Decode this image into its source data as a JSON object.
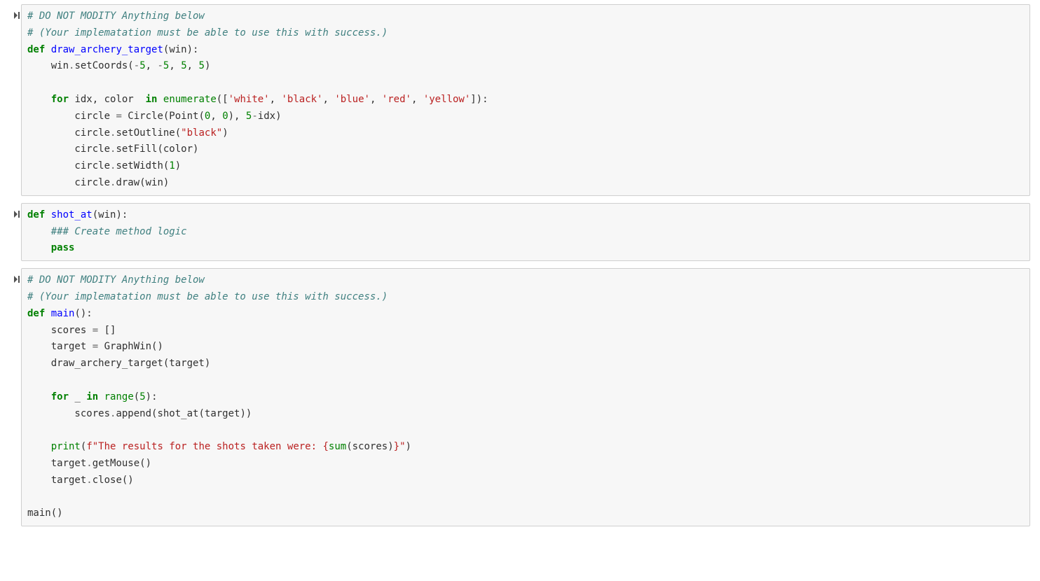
{
  "cells": [
    {
      "id": "cell-1",
      "lines": [
        [
          {
            "t": "# DO NOT MODITY Anything below",
            "c": "tok-comment"
          }
        ],
        [
          {
            "t": "# (Your implematation must be able to use this with success.)",
            "c": "tok-comment"
          }
        ],
        [
          {
            "t": "def",
            "c": "tok-kw"
          },
          {
            "t": " ",
            "c": ""
          },
          {
            "t": "draw_archery_target",
            "c": "tok-fn"
          },
          {
            "t": "(win):",
            "c": ""
          }
        ],
        [
          {
            "t": "    win",
            "c": ""
          },
          {
            "t": ".",
            "c": "tok-op"
          },
          {
            "t": "setCoords(",
            "c": ""
          },
          {
            "t": "-",
            "c": "tok-op"
          },
          {
            "t": "5",
            "c": "tok-num"
          },
          {
            "t": ", ",
            "c": ""
          },
          {
            "t": "-",
            "c": "tok-op"
          },
          {
            "t": "5",
            "c": "tok-num"
          },
          {
            "t": ", ",
            "c": ""
          },
          {
            "t": "5",
            "c": "tok-num"
          },
          {
            "t": ", ",
            "c": ""
          },
          {
            "t": "5",
            "c": "tok-num"
          },
          {
            "t": ")",
            "c": ""
          }
        ],
        [
          {
            "t": "",
            "c": ""
          }
        ],
        [
          {
            "t": "    ",
            "c": ""
          },
          {
            "t": "for",
            "c": "tok-kw"
          },
          {
            "t": " idx, color  ",
            "c": ""
          },
          {
            "t": "in",
            "c": "tok-kw"
          },
          {
            "t": " ",
            "c": ""
          },
          {
            "t": "enumerate",
            "c": "tok-builtin"
          },
          {
            "t": "([",
            "c": ""
          },
          {
            "t": "'white'",
            "c": "tok-str"
          },
          {
            "t": ", ",
            "c": ""
          },
          {
            "t": "'black'",
            "c": "tok-str"
          },
          {
            "t": ", ",
            "c": ""
          },
          {
            "t": "'blue'",
            "c": "tok-str"
          },
          {
            "t": ", ",
            "c": ""
          },
          {
            "t": "'red'",
            "c": "tok-str"
          },
          {
            "t": ", ",
            "c": ""
          },
          {
            "t": "'yellow'",
            "c": "tok-str"
          },
          {
            "t": "]):",
            "c": ""
          }
        ],
        [
          {
            "t": "        circle ",
            "c": ""
          },
          {
            "t": "=",
            "c": "tok-op"
          },
          {
            "t": " Circle(Point(",
            "c": ""
          },
          {
            "t": "0",
            "c": "tok-num"
          },
          {
            "t": ", ",
            "c": ""
          },
          {
            "t": "0",
            "c": "tok-num"
          },
          {
            "t": "), ",
            "c": ""
          },
          {
            "t": "5",
            "c": "tok-num"
          },
          {
            "t": "-",
            "c": "tok-op"
          },
          {
            "t": "idx)",
            "c": ""
          }
        ],
        [
          {
            "t": "        circle",
            "c": ""
          },
          {
            "t": ".",
            "c": "tok-op"
          },
          {
            "t": "setOutline(",
            "c": ""
          },
          {
            "t": "\"black\"",
            "c": "tok-str"
          },
          {
            "t": ")",
            "c": ""
          }
        ],
        [
          {
            "t": "        circle",
            "c": ""
          },
          {
            "t": ".",
            "c": "tok-op"
          },
          {
            "t": "setFill(color)",
            "c": ""
          }
        ],
        [
          {
            "t": "        circle",
            "c": ""
          },
          {
            "t": ".",
            "c": "tok-op"
          },
          {
            "t": "setWidth(",
            "c": ""
          },
          {
            "t": "1",
            "c": "tok-num"
          },
          {
            "t": ")",
            "c": ""
          }
        ],
        [
          {
            "t": "        circle",
            "c": ""
          },
          {
            "t": ".",
            "c": "tok-op"
          },
          {
            "t": "draw(win)",
            "c": ""
          }
        ]
      ]
    },
    {
      "id": "cell-2",
      "lines": [
        [
          {
            "t": "def",
            "c": "tok-kw"
          },
          {
            "t": " ",
            "c": ""
          },
          {
            "t": "shot_at",
            "c": "tok-fn"
          },
          {
            "t": "(win):",
            "c": ""
          }
        ],
        [
          {
            "t": "    ",
            "c": ""
          },
          {
            "t": "### Create method logic",
            "c": "tok-comment"
          }
        ],
        [
          {
            "t": "    ",
            "c": ""
          },
          {
            "t": "pass",
            "c": "tok-kw"
          }
        ]
      ]
    },
    {
      "id": "cell-3",
      "lines": [
        [
          {
            "t": "# DO NOT MODITY Anything below",
            "c": "tok-comment"
          }
        ],
        [
          {
            "t": "# (Your implematation must be able to use this with success.)",
            "c": "tok-comment"
          }
        ],
        [
          {
            "t": "def",
            "c": "tok-kw"
          },
          {
            "t": " ",
            "c": ""
          },
          {
            "t": "main",
            "c": "tok-fn"
          },
          {
            "t": "():",
            "c": ""
          }
        ],
        [
          {
            "t": "    scores ",
            "c": ""
          },
          {
            "t": "=",
            "c": "tok-op"
          },
          {
            "t": " []",
            "c": ""
          }
        ],
        [
          {
            "t": "    target ",
            "c": ""
          },
          {
            "t": "=",
            "c": "tok-op"
          },
          {
            "t": " GraphWin()",
            "c": ""
          }
        ],
        [
          {
            "t": "    draw_archery_target(target)",
            "c": ""
          }
        ],
        [
          {
            "t": "",
            "c": ""
          }
        ],
        [
          {
            "t": "    ",
            "c": ""
          },
          {
            "t": "for",
            "c": "tok-kw"
          },
          {
            "t": " _ ",
            "c": ""
          },
          {
            "t": "in",
            "c": "tok-kw"
          },
          {
            "t": " ",
            "c": ""
          },
          {
            "t": "range",
            "c": "tok-builtin"
          },
          {
            "t": "(",
            "c": ""
          },
          {
            "t": "5",
            "c": "tok-num"
          },
          {
            "t": "):",
            "c": ""
          }
        ],
        [
          {
            "t": "        scores",
            "c": ""
          },
          {
            "t": ".",
            "c": "tok-op"
          },
          {
            "t": "append(shot_at(target))",
            "c": ""
          }
        ],
        [
          {
            "t": "",
            "c": ""
          }
        ],
        [
          {
            "t": "    ",
            "c": ""
          },
          {
            "t": "print",
            "c": "tok-builtin"
          },
          {
            "t": "(",
            "c": ""
          },
          {
            "t": "f\"The results for the shots taken were: ",
            "c": "tok-str"
          },
          {
            "t": "{",
            "c": "tok-fstring-affix"
          },
          {
            "t": "sum",
            "c": "tok-builtin"
          },
          {
            "t": "(scores)",
            "c": ""
          },
          {
            "t": "}",
            "c": "tok-fstring-affix"
          },
          {
            "t": "\"",
            "c": "tok-str"
          },
          {
            "t": ")",
            "c": ""
          }
        ],
        [
          {
            "t": "    target",
            "c": ""
          },
          {
            "t": ".",
            "c": "tok-op"
          },
          {
            "t": "getMouse()",
            "c": ""
          }
        ],
        [
          {
            "t": "    target",
            "c": ""
          },
          {
            "t": ".",
            "c": "tok-op"
          },
          {
            "t": "close()",
            "c": ""
          }
        ],
        [
          {
            "t": "",
            "c": ""
          }
        ],
        [
          {
            "t": "main()",
            "c": ""
          }
        ]
      ]
    }
  ]
}
